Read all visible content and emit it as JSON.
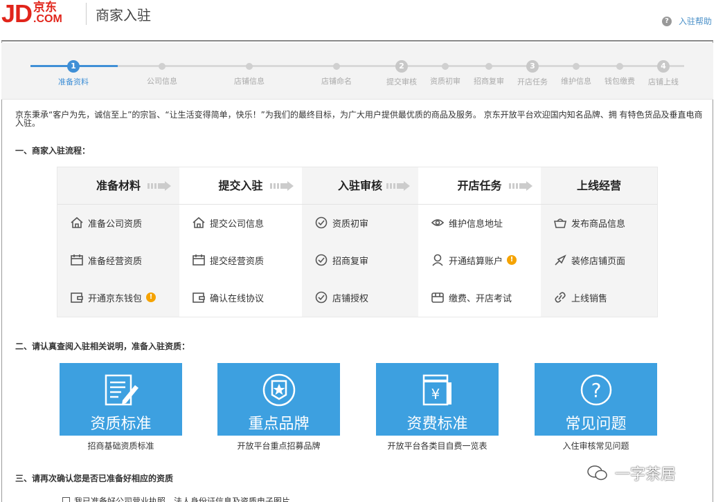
{
  "header": {
    "logo_text": "JD",
    "logo_cn": "京东",
    "logo_com": ".COM",
    "title": "商家入驻",
    "help_label": "入驻帮助"
  },
  "steps": [
    {
      "num": "1",
      "label": "准备资料",
      "active": true
    },
    {
      "label": "公司信息"
    },
    {
      "label": "店铺信息"
    },
    {
      "label": "店铺命名"
    },
    {
      "num": "2",
      "label": "提交审核"
    },
    {
      "label": "资质初审"
    },
    {
      "label": "招商复审"
    },
    {
      "num": "3",
      "label": "开店任务"
    },
    {
      "label": "维护信息"
    },
    {
      "label": "钱包缴费"
    },
    {
      "num": "4",
      "label": "店铺上线"
    }
  ],
  "intro": "京东秉承“客户为先，诚信至上”的宗旨、“让生活变得简单，快乐！”为我们的最终目标，为广大用户提供最优质的商品及服务。 京东开放平台欢迎国内知名品牌、拥 有特色货品及垂直电商入驻。",
  "section1": "一、商家入驻流程：",
  "process": [
    {
      "head": "准备材料",
      "items": [
        "准备公司资质",
        "准备经营资质",
        "开通京东钱包"
      ],
      "icons": [
        "home-icon",
        "calendar-icon",
        "wallet-icon"
      ],
      "warn": [
        false,
        false,
        true
      ]
    },
    {
      "head": "提交入驻",
      "items": [
        "提交公司信息",
        "提交经营资质",
        "确认在线协议"
      ],
      "icons": [
        "home-icon",
        "calendar-icon",
        "wallet-icon"
      ],
      "warn": [
        false,
        false,
        false
      ]
    },
    {
      "head": "入驻审核",
      "items": [
        "资质初审",
        "招商复审",
        "店铺授权"
      ],
      "icons": [
        "check-circle-icon",
        "check-circle-icon",
        "check-circle-icon"
      ],
      "warn": [
        false,
        false,
        false
      ]
    },
    {
      "head": "开店任务",
      "items": [
        "维护信息地址",
        "开通结算账户",
        "缴费、开店考试"
      ],
      "icons": [
        "location-icon",
        "person-icon",
        "store-icon"
      ],
      "warn": [
        false,
        true,
        false
      ]
    },
    {
      "head": "上线经营",
      "items": [
        "发布商品信息",
        "装修店铺页面",
        "上线销售"
      ],
      "icons": [
        "cart-icon",
        "brush-icon",
        "link-icon"
      ],
      "warn": [
        false,
        false,
        false
      ]
    }
  ],
  "warn_glyph": "!",
  "section2": "二、请认真查阅入驻相关说明，准备入驻资质：",
  "cards": [
    {
      "title": "资质标准",
      "caption": "招商基础资质标准",
      "icon": "document-edit-icon"
    },
    {
      "title": "重点品牌",
      "caption": "开放平台重点招募品牌",
      "icon": "star-badge-icon"
    },
    {
      "title": "资费标准",
      "caption": "开放平台各类目自费一览表",
      "icon": "yen-icon"
    },
    {
      "title": "常见问题",
      "caption": "入住审核常见问题",
      "icon": "question-icon"
    }
  ],
  "section3": "三、请再次确认您是否已准备好相应的资质",
  "confirm_text": "我已准备好公司营业执照、法人身份证信息及资质电子图片",
  "watermark": "一字茶居",
  "colors": {
    "brand_red": "#e1251b",
    "accent_blue": "#3f8fd6",
    "card_blue": "#3da0e0",
    "warning": "#f5a300"
  }
}
